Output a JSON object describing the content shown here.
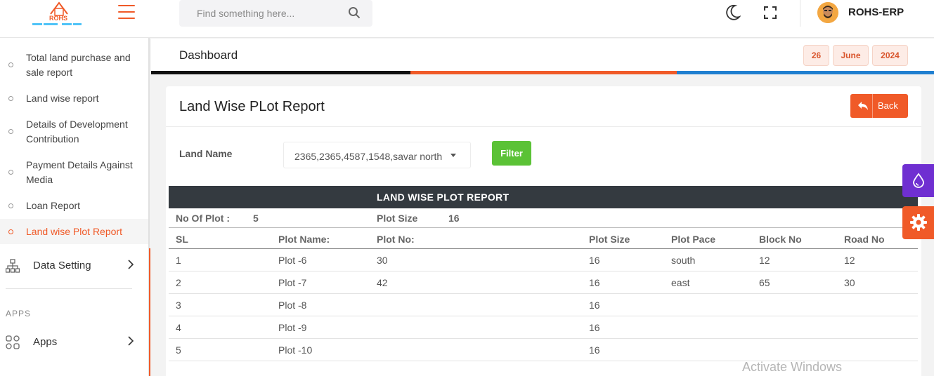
{
  "brand": {
    "logo_text": "ROHS",
    "accent_color": "#f05a28"
  },
  "topbar": {
    "search_placeholder": "Find something here...",
    "username": "ROHS-ERP"
  },
  "sidebar": {
    "items": [
      {
        "label": "Total land purchase and sale report",
        "active": false
      },
      {
        "label": "Land wise report",
        "active": false
      },
      {
        "label": "Details of Development Contribution",
        "active": false
      },
      {
        "label": "Payment Details Against Media",
        "active": false
      },
      {
        "label": "Loan Report",
        "active": false
      },
      {
        "label": "Land wise Plot Report",
        "active": true
      }
    ],
    "data_setting_label": "Data Setting",
    "apps_heading": "APPS",
    "apps_label": "Apps"
  },
  "dashboard": {
    "title": "Dashboard",
    "date": {
      "day": "26",
      "month": "June",
      "year": "2024"
    }
  },
  "card": {
    "title": "Land Wise PLot Report",
    "back_label": "Back",
    "land_name_label": "Land Name",
    "land_name_value": "2365,2365,4587,1548,savar north",
    "filter_label": "Filter"
  },
  "report": {
    "heading": "LAND WISE PLOT REPORT",
    "summary": {
      "no_of_plot_label": "No Of Plot :",
      "no_of_plot_value": "5",
      "plot_size_label": "Plot Size",
      "plot_size_value": "16"
    },
    "columns": [
      "SL",
      "Plot Name:",
      "Plot No:",
      "Plot Size",
      "Plot Pace",
      "Block No",
      "Road No"
    ],
    "rows": [
      [
        "1",
        "Plot -6",
        "30",
        "16",
        "south",
        "12",
        "12"
      ],
      [
        "2",
        "Plot -7",
        "42",
        "16",
        "east",
        "65",
        "30"
      ],
      [
        "3",
        "Plot -8",
        "",
        "16",
        "",
        "",
        ""
      ],
      [
        "4",
        "Plot -9",
        "",
        "16",
        "",
        "",
        ""
      ],
      [
        "5",
        "Plot -10",
        "",
        "16",
        "",
        "",
        ""
      ]
    ]
  },
  "watermark": "Activate Windows"
}
